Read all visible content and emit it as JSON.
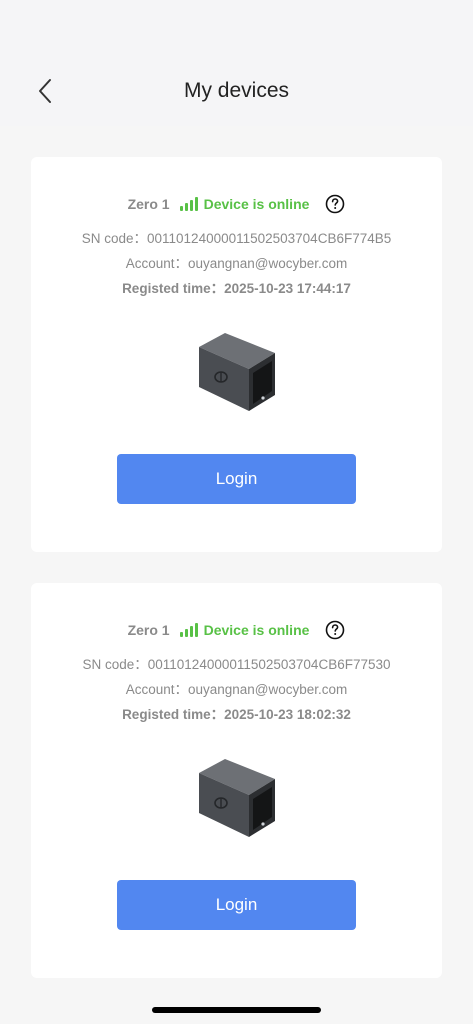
{
  "header": {
    "title": "My devices",
    "back_icon": "chevron-left-icon"
  },
  "devices": [
    {
      "model": "Zero 1",
      "status": "Device is online",
      "sn_line": "SN code：00110124000011502503704CB6F774B5",
      "account_line": "Account：ouyangnan@wocyber.com",
      "time_line": "Registed time：2025-10-23 17:44:17",
      "login_label": "Login"
    },
    {
      "model": "Zero 1",
      "status": "Device is online",
      "sn_line": "SN code：00110124000011502503704CB6F77530",
      "account_line": "Account：ouyangnan@wocyber.com",
      "time_line": "Registed time：2025-10-23 18:02:32",
      "login_label": "Login"
    }
  ],
  "colors": {
    "accent": "#5287f0",
    "online": "#58c146",
    "muted_text": "#8a8a8a"
  }
}
